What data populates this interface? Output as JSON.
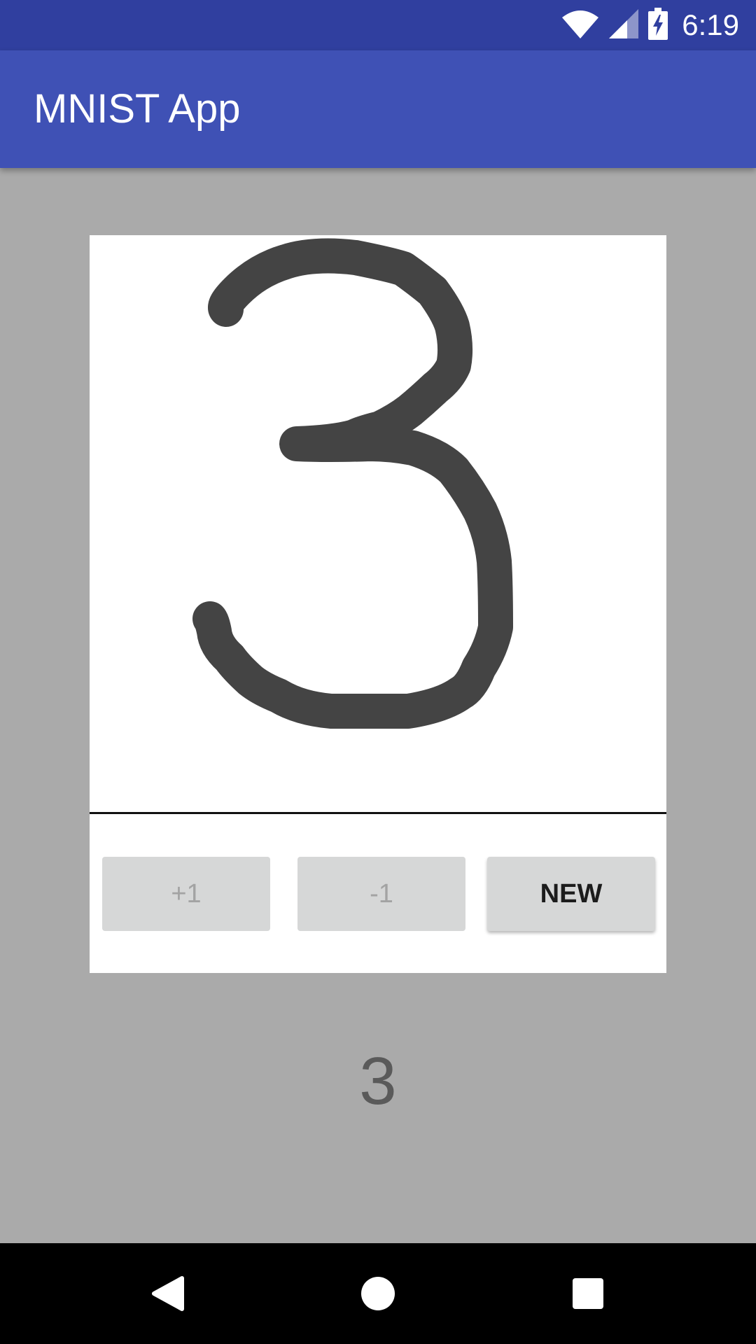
{
  "status_bar": {
    "time": "6:19",
    "icons": [
      "wifi-icon",
      "cellular-signal-icon",
      "battery-charging-icon"
    ]
  },
  "app_bar": {
    "title": "MNIST App",
    "color": "#3f51b5"
  },
  "canvas": {
    "drawn_content": "handwritten digit 3",
    "stroke_color": "#444444"
  },
  "buttons": {
    "plus_label": "+1",
    "minus_label": "-1",
    "new_label": "NEW"
  },
  "prediction": {
    "value": "3"
  },
  "nav_bar": {
    "icons": [
      "back-icon",
      "home-icon",
      "recents-icon"
    ]
  }
}
